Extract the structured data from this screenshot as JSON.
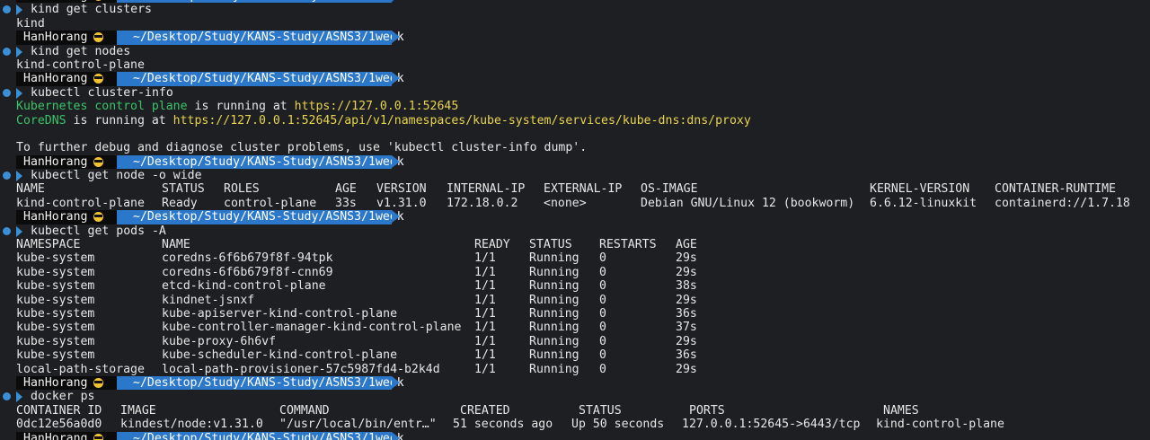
{
  "prompt": {
    "user": "HanHorang",
    "path": "~/Desktop/Study/KANS-Study/ASNS3/1week"
  },
  "lines": {
    "cmd_get_clusters": "kind get clusters",
    "out_kind": "kind",
    "cmd_get_nodes": "kind get nodes",
    "out_node": "kind-control-plane",
    "cmd_cluster_info": "kubectl cluster-info",
    "ci_1_a": "Kubernetes control plane",
    "ci_1_b": " is running at ",
    "ci_1_c": "https://127.0.0.1:52645",
    "ci_2_a": "CoreDNS",
    "ci_2_b": " is running at ",
    "ci_2_c": "https://127.0.0.1:52645/api/v1/namespaces/kube-system/services/kube-dns:dns/proxy",
    "ci_debug": "To further debug and diagnose cluster problems, use 'kubectl cluster-info dump'.",
    "cmd_get_node_wide": "kubectl get node -o wide",
    "cmd_get_pods": "kubectl get pods -A",
    "cmd_docker_ps": "docker ps"
  },
  "node_table": {
    "headers": [
      "NAME",
      "STATUS",
      "ROLES",
      "AGE",
      "VERSION",
      "INTERNAL-IP",
      "EXTERNAL-IP",
      "OS-IMAGE",
      "KERNEL-VERSION",
      "CONTAINER-RUNTIME"
    ],
    "rows": [
      [
        "kind-control-plane",
        "Ready",
        "control-plane",
        "33s",
        "v1.31.0",
        "172.18.0.2",
        "<none>",
        "Debian GNU/Linux 12 (bookworm)",
        "6.6.12-linuxkit",
        "containerd://1.7.18"
      ]
    ]
  },
  "pods_table": {
    "headers": [
      "NAMESPACE",
      "NAME",
      "READY",
      "STATUS",
      "RESTARTS",
      "AGE"
    ],
    "rows": [
      [
        "kube-system",
        "coredns-6f6b679f8f-94tpk",
        "1/1",
        "Running",
        "0",
        "29s"
      ],
      [
        "kube-system",
        "coredns-6f6b679f8f-cnn69",
        "1/1",
        "Running",
        "0",
        "29s"
      ],
      [
        "kube-system",
        "etcd-kind-control-plane",
        "1/1",
        "Running",
        "0",
        "38s"
      ],
      [
        "kube-system",
        "kindnet-jsnxf",
        "1/1",
        "Running",
        "0",
        "29s"
      ],
      [
        "kube-system",
        "kube-apiserver-kind-control-plane",
        "1/1",
        "Running",
        "0",
        "36s"
      ],
      [
        "kube-system",
        "kube-controller-manager-kind-control-plane",
        "1/1",
        "Running",
        "0",
        "37s"
      ],
      [
        "kube-system",
        "kube-proxy-6h6vf",
        "1/1",
        "Running",
        "0",
        "29s"
      ],
      [
        "kube-system",
        "kube-scheduler-kind-control-plane",
        "1/1",
        "Running",
        "0",
        "36s"
      ],
      [
        "local-path-storage",
        "local-path-provisioner-57c5987fd4-b2k4d",
        "1/1",
        "Running",
        "0",
        "29s"
      ]
    ]
  },
  "docker_table": {
    "headers": [
      "CONTAINER ID",
      "IMAGE",
      "COMMAND",
      "CREATED",
      "STATUS",
      "PORTS",
      "NAMES"
    ],
    "rows": [
      [
        "0dc12e56a0d0",
        "kindest/node:v1.31.0",
        "\"/usr/local/bin/entr…\"",
        "51 seconds ago",
        "Up 50 seconds",
        "127.0.0.1:52645->6443/tcp",
        "kind-control-plane"
      ]
    ]
  },
  "colors": {
    "background": "#1e1f22",
    "prompt_path_bg": "#2b77c9",
    "prompt_user_bg": "#0b0b0b",
    "green": "#39c46a",
    "yellow": "#e8d44d"
  },
  "icons": {
    "prompt_emoji": "sunglasses-face-icon",
    "line_marker": "blue-dot-icon",
    "command_marker": "chevron-right-icon"
  }
}
